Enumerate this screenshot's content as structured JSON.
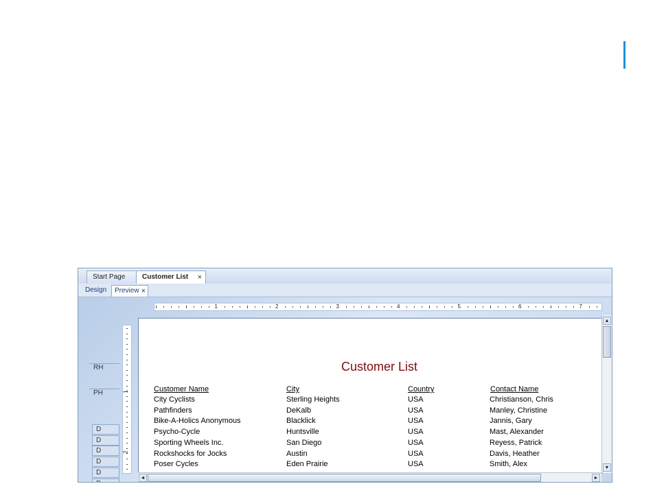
{
  "colors": {
    "accent": "#1e8fd6",
    "title": "#7a0c0c"
  },
  "doc_tabs": [
    {
      "label": "Start Page"
    },
    {
      "label": "Customer List",
      "close": "×"
    }
  ],
  "view_tabs": [
    {
      "label": "Design"
    },
    {
      "label": "Preview",
      "close": "×"
    }
  ],
  "ruler": {
    "h_marks": [
      "1",
      "2",
      "3",
      "4",
      "5",
      "6",
      "7"
    ],
    "v_marks": [
      "1",
      "2"
    ]
  },
  "bands": {
    "rh": "RH",
    "ph": "PH",
    "detail": "D"
  },
  "report": {
    "title": "Customer List",
    "columns": [
      "Customer Name",
      "City",
      "Country",
      "Contact Name"
    ],
    "rows": [
      [
        "City Cyclists",
        "Sterling Heights",
        "USA",
        "Christianson, Chris"
      ],
      [
        "Pathfinders",
        "DeKalb",
        "USA",
        "Manley, Christine"
      ],
      [
        "Bike-A-Holics Anonymous",
        "Blacklick",
        "USA",
        "Jannis, Gary"
      ],
      [
        "Psycho-Cycle",
        "Huntsville",
        "USA",
        "Mast, Alexander"
      ],
      [
        "Sporting Wheels Inc.",
        "San Diego",
        "USA",
        "Reyess, Patrick"
      ],
      [
        "Rockshocks for Jocks",
        "Austin",
        "USA",
        "Davis, Heather"
      ],
      [
        "Poser Cycles",
        "Eden Prairie",
        "USA",
        "Smith, Alex"
      ]
    ]
  },
  "scroll": {
    "up": "▲",
    "down": "▼",
    "left": "◄",
    "right": "►"
  }
}
